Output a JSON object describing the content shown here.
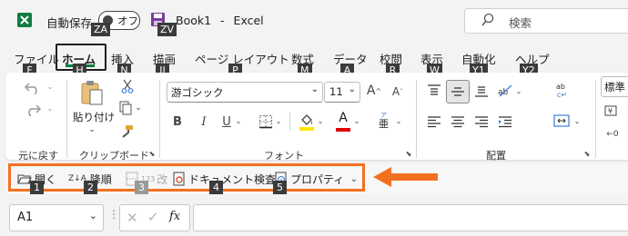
{
  "titlebar": {
    "autosave_label": "自動保存",
    "autosave_state": "オフ",
    "book_name": "Book1",
    "separator": "-",
    "app_name": "Excel",
    "search_placeholder": "検索"
  },
  "tabs": [
    {
      "label": "ファイル",
      "keytip": "F"
    },
    {
      "label": "ホーム",
      "keytip": "H"
    },
    {
      "label": "挿入",
      "keytip": "N"
    },
    {
      "label": "描画",
      "keytip": "JI"
    },
    {
      "label": "ページ レイアウト",
      "keytip": "P"
    },
    {
      "label": "数式",
      "keytip": "M"
    },
    {
      "label": "データ",
      "keytip": "A"
    },
    {
      "label": "校閲",
      "keytip": "R"
    },
    {
      "label": "表示",
      "keytip": "W"
    },
    {
      "label": "自動化",
      "keytip": "Y1"
    },
    {
      "label": "ヘルプ",
      "keytip": "Y2"
    }
  ],
  "keytips_top": {
    "autosave": "ZA",
    "save": "ZV"
  },
  "ribbon": {
    "undo_group": "元に戻す",
    "clipboard_group": "クリップボード",
    "paste_label": "貼り付け",
    "font_group": "フォント",
    "font_name": "游ゴシック",
    "font_size": "11",
    "bold": "B",
    "italic": "I",
    "underline": "U",
    "font_color_label": "A",
    "phonetic_label": "亜",
    "align_group": "配置",
    "right_partial": "標準"
  },
  "qat": {
    "items": [
      {
        "label": "開く",
        "keytip": "1"
      },
      {
        "label": "降順",
        "keytip": "2"
      },
      {
        "label": "改",
        "keytip": "3"
      },
      {
        "label": "ドキュメント検査",
        "keytip": "4"
      },
      {
        "label": "プロパティ",
        "keytip": "5"
      }
    ],
    "sort_icon_text": "Z↓A",
    "count_icon_text": "123"
  },
  "formula_bar": {
    "name_box": "A1",
    "fx": "fx"
  },
  "colors": {
    "accent_orange": "#f37021",
    "excel_green": "#107c41",
    "keytip_bg": "#3b3b3b"
  }
}
